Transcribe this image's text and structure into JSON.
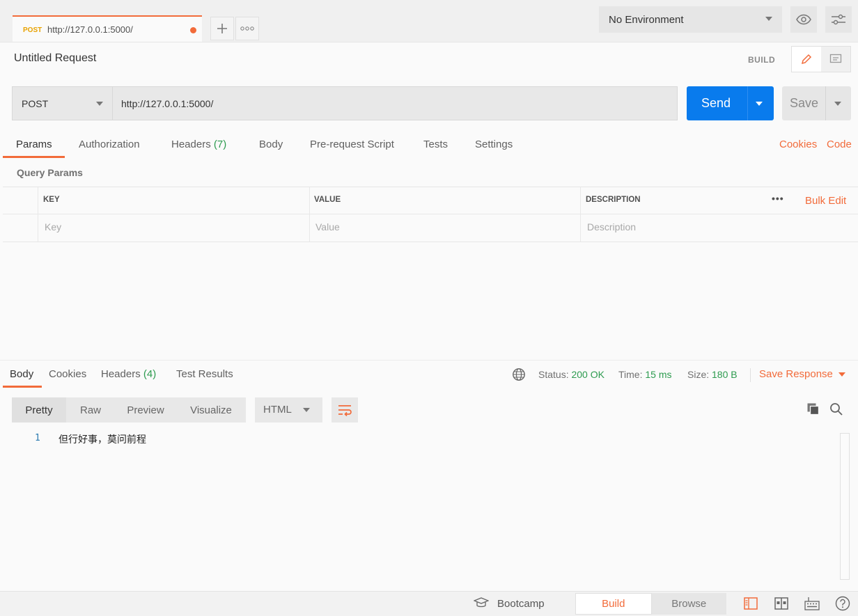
{
  "tabstrip": {
    "tab": {
      "method": "POST",
      "url": "http://127.0.0.1:5000/"
    },
    "environment": "No Environment"
  },
  "request": {
    "title": "Untitled Request",
    "mode_label": "BUILD",
    "method": "POST",
    "url": "http://127.0.0.1:5000/",
    "send_label": "Send",
    "save_label": "Save"
  },
  "req_tabs": {
    "params": "Params",
    "authorization": "Authorization",
    "headers": "Headers",
    "headers_count": "(7)",
    "body": "Body",
    "prerequest": "Pre-request Script",
    "tests": "Tests",
    "settings": "Settings",
    "cookies": "Cookies",
    "code": "Code"
  },
  "query_params": {
    "label": "Query Params",
    "columns": [
      "KEY",
      "VALUE",
      "DESCRIPTION"
    ],
    "placeholders": [
      "Key",
      "Value",
      "Description"
    ],
    "bulk_edit": "Bulk Edit",
    "more": "•••"
  },
  "response": {
    "tabs": {
      "body": "Body",
      "cookies": "Cookies",
      "headers": "Headers",
      "headers_count": "(4)",
      "test_results": "Test Results"
    },
    "status_label": "Status:",
    "status_value": "200 OK",
    "time_label": "Time:",
    "time_value": "15 ms",
    "size_label": "Size:",
    "size_value": "180 B",
    "save_response": "Save Response",
    "formats": [
      "Pretty",
      "Raw",
      "Preview",
      "Visualize"
    ],
    "language": "HTML",
    "line_number": "1",
    "body_line": "但行好事，莫问前程"
  },
  "footer": {
    "bootcamp": "Bootcamp",
    "build": "Build",
    "browse": "Browse"
  },
  "colors": {
    "accent": "#f26b3a",
    "send": "#097bed",
    "success": "#2d9b4f",
    "method_post": "#e8a200"
  },
  "icons": [
    "plus-icon",
    "more-icon",
    "eye-icon",
    "sliders-icon",
    "pencil-icon",
    "comment-icon",
    "globe-icon",
    "wrap-icon",
    "copy-icon",
    "search-icon",
    "bootcamp-icon",
    "sidebar-icon",
    "two-pane-icon",
    "keyboard-icon",
    "help-icon"
  ]
}
